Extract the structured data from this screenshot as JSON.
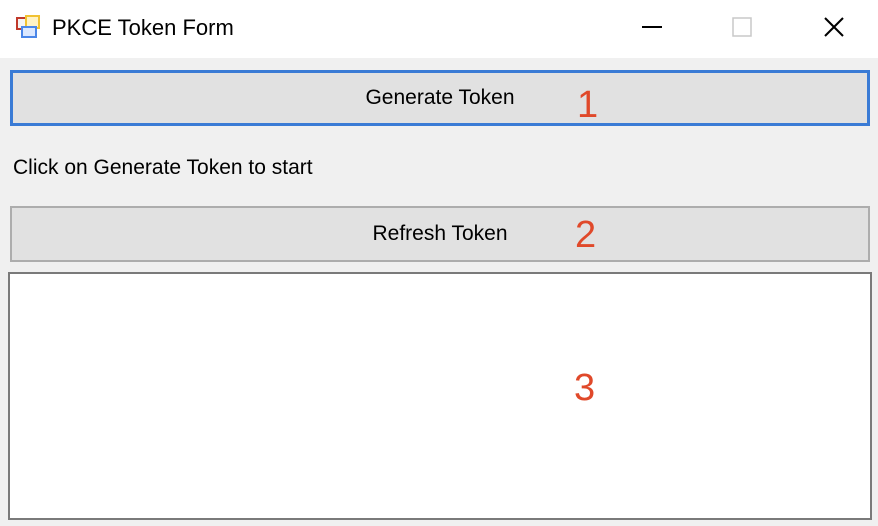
{
  "window": {
    "title": "PKCE Token Form",
    "icon": "app-window-icon",
    "controls": {
      "minimize_icon": "minimize-icon",
      "maximize_icon": "maximize-icon",
      "close_icon": "close-icon"
    }
  },
  "main": {
    "generate_button_label": "Generate Token",
    "status_text": "Click on Generate Token to start",
    "refresh_button_label": "Refresh Token",
    "output_value": ""
  },
  "annotations": {
    "marker_1": "1",
    "marker_2": "2",
    "marker_3": "3"
  },
  "colors": {
    "focus_border": "#3a7bd5",
    "annotation": "#e0492a",
    "button_face": "#e1e1e1",
    "window_bg": "#f0f0f0"
  }
}
